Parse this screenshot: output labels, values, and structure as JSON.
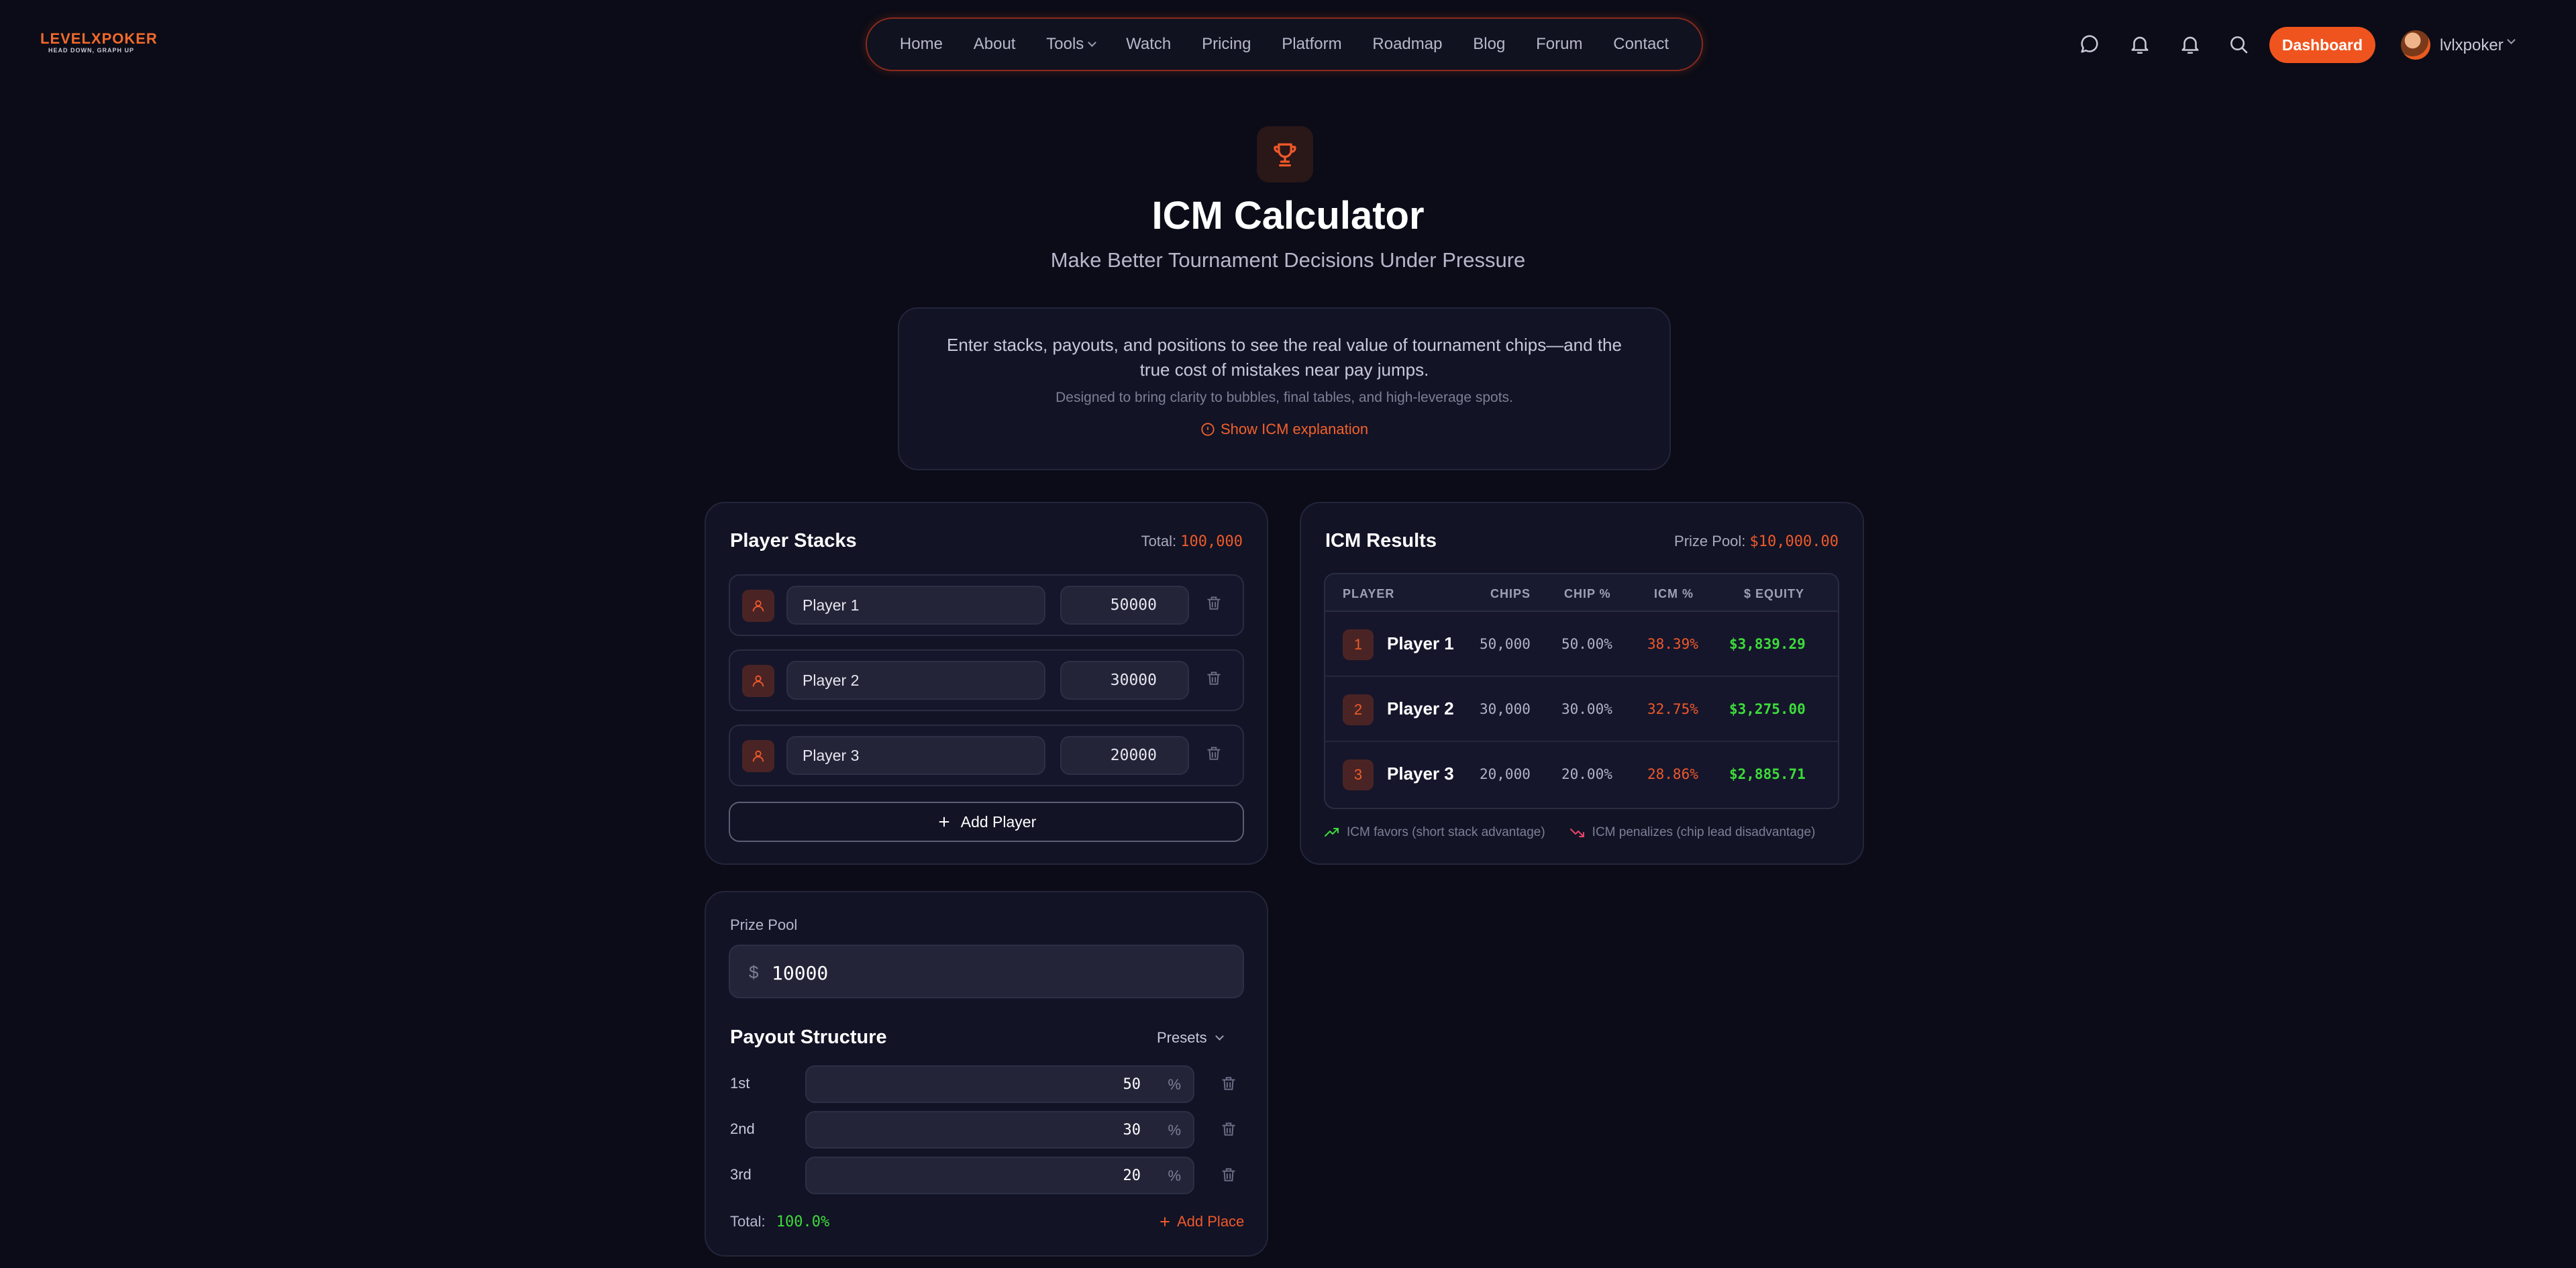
{
  "header": {
    "logo_main": "LEVELXPOKER",
    "logo_tagline": "HEAD DOWN, GRAPH UP",
    "nav": [
      "Home",
      "About",
      "Tools",
      "Watch",
      "Pricing",
      "Platform",
      "Roadmap",
      "Blog",
      "Forum",
      "Contact"
    ],
    "dashboard_label": "Dashboard",
    "username": "lvlxpoker",
    "icons": [
      "chat-icon",
      "bell-icon",
      "bell-icon",
      "search-icon"
    ]
  },
  "hero": {
    "title": "ICM Calculator",
    "subtitle": "Make Better Tournament Decisions Under Pressure",
    "intro_p1": "Enter stacks, payouts, and positions to see the real value of tournament chips—and the true cost of mistakes near pay jumps.",
    "intro_p2": "Designed to bring clarity to bubbles, final tables, and high-leverage spots.",
    "explain_link": "Show ICM explanation"
  },
  "stacks": {
    "title": "Player Stacks",
    "total_label": "Total:",
    "total_value": "100,000",
    "players": [
      {
        "name": "Player 1",
        "chips": "50000"
      },
      {
        "name": "Player 2",
        "chips": "30000"
      },
      {
        "name": "Player 3",
        "chips": "20000"
      }
    ],
    "add_label": "Add Player"
  },
  "results": {
    "title": "ICM Results",
    "pool_label": "Prize Pool:",
    "pool_value": "$10,000.00",
    "columns": [
      "PLAYER",
      "CHIPS",
      "CHIP %",
      "ICM %",
      "$ EQUITY"
    ],
    "rows": [
      {
        "rank": "1",
        "name": "Player 1",
        "chips": "50,000",
        "chip_pct": "50.00%",
        "icm_pct": "38.39%",
        "equity": "$3,839.29"
      },
      {
        "rank": "2",
        "name": "Player 2",
        "chips": "30,000",
        "chip_pct": "30.00%",
        "icm_pct": "32.75%",
        "equity": "$3,275.00"
      },
      {
        "rank": "3",
        "name": "Player 3",
        "chips": "20,000",
        "chip_pct": "20.00%",
        "icm_pct": "28.86%",
        "equity": "$2,885.71"
      }
    ],
    "legend_favors": "ICM favors (short stack advantage)",
    "legend_penalizes": "ICM penalizes (chip lead disadvantage)",
    "colors": {
      "accent": "#f05a28",
      "positive": "#3ddc3a",
      "negative": "#e8456a"
    }
  },
  "payout": {
    "prize_label": "Prize Pool",
    "currency": "$",
    "prize_value": "10000",
    "structure_title": "Payout Structure",
    "presets_label": "Presets",
    "places": [
      {
        "place": "1st",
        "pct": "50",
        "unit": "%"
      },
      {
        "place": "2nd",
        "pct": "30",
        "unit": "%"
      },
      {
        "place": "3rd",
        "pct": "20",
        "unit": "%"
      }
    ],
    "total_label": "Total:",
    "total_value": "100.0%",
    "add_place_label": "Add Place"
  }
}
